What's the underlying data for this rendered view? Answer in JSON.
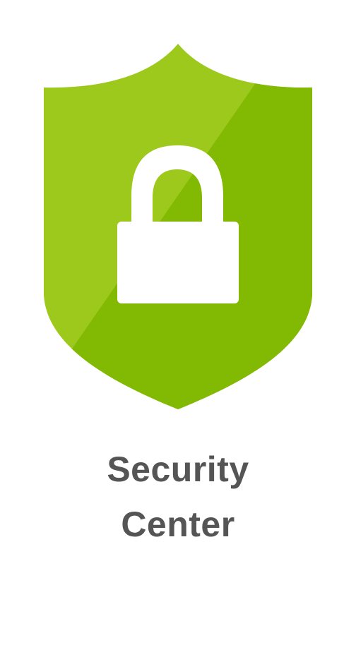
{
  "app": {
    "icon": "shield-lock-icon",
    "label_line1": "Security",
    "label_line2": "Center"
  },
  "colors": {
    "shield_light": "#9cc91c",
    "shield_dark": "#82b902",
    "lock": "#ffffff",
    "label_text": "#555555",
    "background": "#ffffff"
  }
}
